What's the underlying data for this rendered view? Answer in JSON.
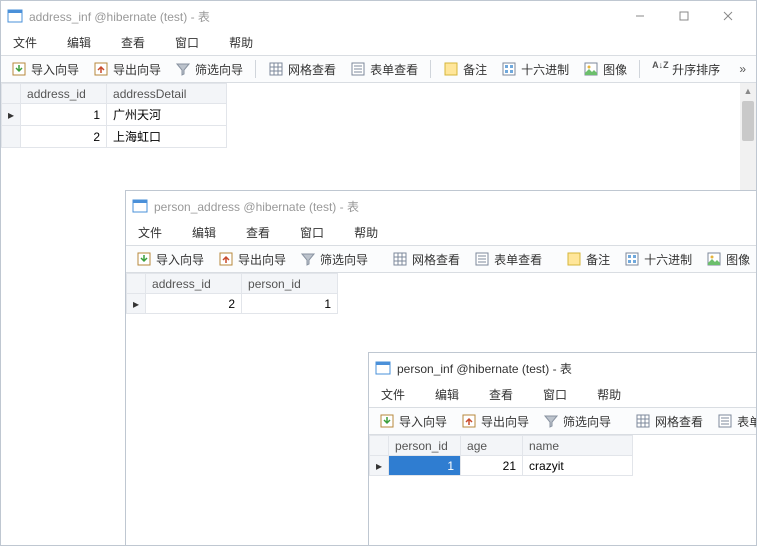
{
  "win1": {
    "title": "address_inf @hibernate (test) - 表",
    "menu": {
      "file": "文件",
      "edit": "编辑",
      "view": "查看",
      "window": "窗口",
      "help": "帮助"
    },
    "toolbar": {
      "import": "导入向导",
      "export": "导出向导",
      "filter": "筛选向导",
      "gridview": "网格查看",
      "formview": "表单查看",
      "note": "备注",
      "hex": "十六进制",
      "image": "图像",
      "sort": "升序排序"
    },
    "table": {
      "cols": [
        "address_id",
        "addressDetail"
      ],
      "rows": [
        {
          "id": "1",
          "detail": "广州天河",
          "pointer": "▸"
        },
        {
          "id": "2",
          "detail": "上海虹口",
          "pointer": ""
        }
      ]
    }
  },
  "win2": {
    "title": "person_address @hibernate (test) - 表",
    "menu": {
      "file": "文件",
      "edit": "编辑",
      "view": "查看",
      "window": "窗口",
      "help": "帮助"
    },
    "toolbar": {
      "import": "导入向导",
      "export": "导出向导",
      "filter": "筛选向导",
      "gridview": "网格查看",
      "formview": "表单查看",
      "note": "备注",
      "hex": "十六进制",
      "image": "图像"
    },
    "table": {
      "cols": [
        "address_id",
        "person_id"
      ],
      "rows": [
        {
          "aid": "2",
          "pid": "1",
          "pointer": "▸"
        }
      ]
    }
  },
  "win3": {
    "title": "person_inf @hibernate (test) - 表",
    "menu": {
      "file": "文件",
      "edit": "编辑",
      "view": "查看",
      "window": "窗口",
      "help": "帮助"
    },
    "toolbar": {
      "import": "导入向导",
      "export": "导出向导",
      "filter": "筛选向导",
      "gridview": "网格查看",
      "formview": "表单查看"
    },
    "table": {
      "cols": [
        "person_id",
        "age",
        "name"
      ],
      "rows": [
        {
          "pid": "1",
          "age": "21",
          "name": "crazyit",
          "pointer": "▸"
        }
      ]
    }
  },
  "icons": {
    "sortAZ": "A↓Z"
  }
}
